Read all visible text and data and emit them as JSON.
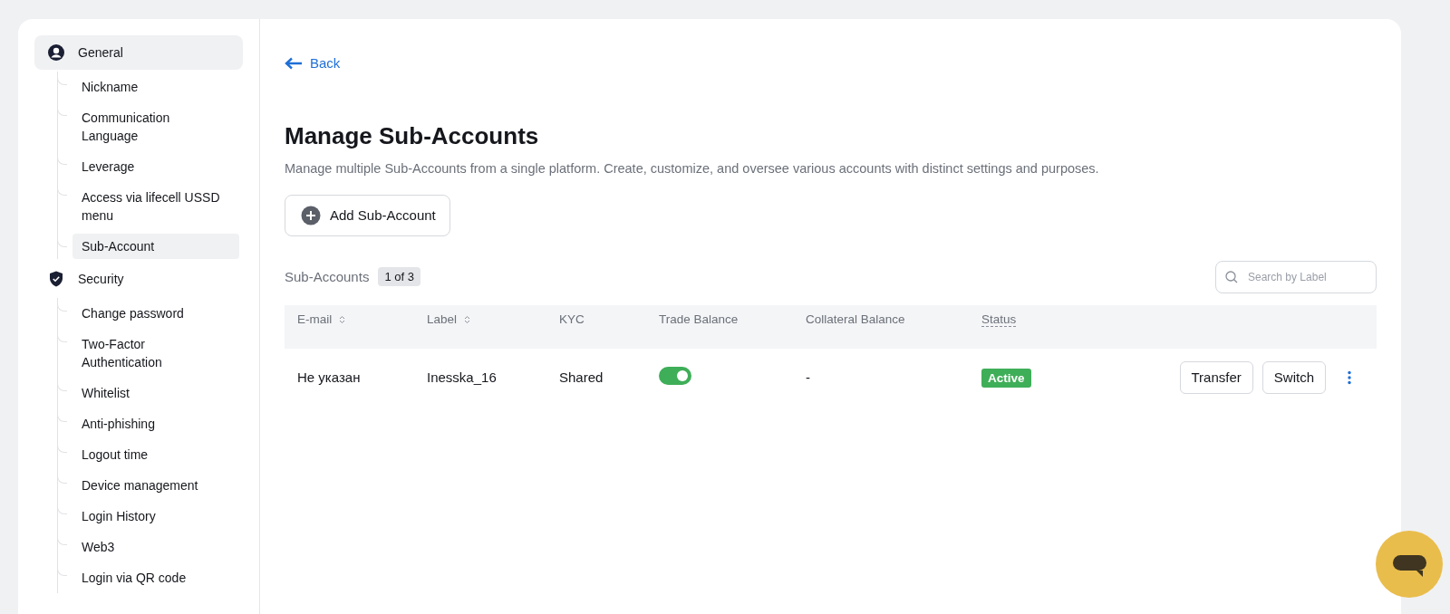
{
  "sidebar": {
    "groups": [
      {
        "label": "General",
        "selected": true,
        "items": [
          {
            "label": "Nickname",
            "selected": false
          },
          {
            "label": "Communication Language",
            "selected": false
          },
          {
            "label": "Leverage",
            "selected": false
          },
          {
            "label": "Access via lifecell USSD menu",
            "selected": false
          },
          {
            "label": "Sub-Account",
            "selected": true
          }
        ]
      },
      {
        "label": "Security",
        "selected": false,
        "items": [
          {
            "label": "Change password",
            "selected": false
          },
          {
            "label": "Two-Factor Authentication",
            "selected": false
          },
          {
            "label": "Whitelist",
            "selected": false
          },
          {
            "label": "Anti-phishing",
            "selected": false
          },
          {
            "label": "Logout time",
            "selected": false
          },
          {
            "label": "Device management",
            "selected": false
          },
          {
            "label": "Login History",
            "selected": false
          },
          {
            "label": "Web3",
            "selected": false
          },
          {
            "label": "Login via QR code",
            "selected": false
          }
        ]
      }
    ]
  },
  "back": "Back",
  "title": "Manage Sub-Accounts",
  "description": "Manage multiple Sub-Accounts from a single platform. Create, customize, and oversee various accounts with distinct settings and purposes.",
  "add_button": "Add Sub-Account",
  "list_label": "Sub-Accounts",
  "count": "1 of 3",
  "search": {
    "placeholder": "Search by Label"
  },
  "table": {
    "columns": [
      {
        "label": "E-mail",
        "kind": "sortable"
      },
      {
        "label": "Label",
        "kind": "sortable"
      },
      {
        "label": "KYC",
        "kind": "plain"
      },
      {
        "label": "Trade Balance",
        "kind": "plain"
      },
      {
        "label": "Collateral Balance",
        "kind": "plain"
      },
      {
        "label": "Status",
        "kind": "hint"
      }
    ],
    "rows": [
      {
        "email": "Не указан",
        "label": "Inesska_16",
        "kyc": "Shared",
        "trade_balance_on": true,
        "collateral": "-",
        "status": "Active",
        "actions": [
          "Transfer",
          "Switch"
        ]
      }
    ]
  }
}
